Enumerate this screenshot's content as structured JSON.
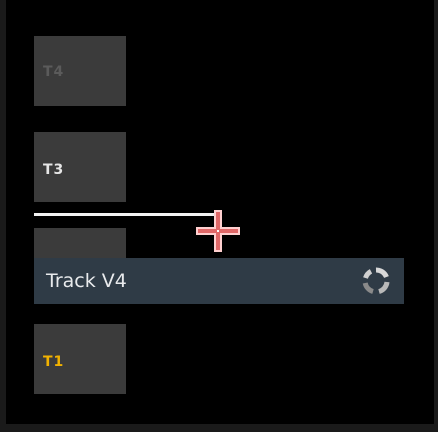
{
  "tracks": [
    {
      "id": "T4",
      "label": "T4",
      "state": "dimmed",
      "color": "#5b5b5b"
    },
    {
      "id": "T3",
      "label": "T3",
      "state": "normal",
      "color": "#e6e6e6"
    },
    {
      "id": "T2",
      "label": "",
      "state": "partially-covered",
      "color": "#3b3b3b"
    },
    {
      "id": "T1",
      "label": "T1",
      "state": "active",
      "color": "#f2b200"
    }
  ],
  "drag_item": {
    "name": "Track V4",
    "icon": "sync-icon"
  },
  "colors": {
    "background": "#000000",
    "tile": "#3b3b3b",
    "drag_bar": "#2f3b46",
    "active_label": "#f2b200",
    "drop_line": "#f2f2f2",
    "cursor": "#f07070"
  },
  "cursor": {
    "icon": "move-crosshair-icon"
  }
}
